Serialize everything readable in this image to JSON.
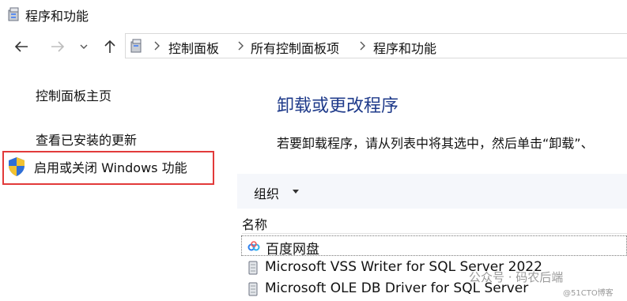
{
  "window": {
    "title": "程序和功能"
  },
  "nav": {
    "address": [
      "控制面板",
      "所有控制面板项",
      "程序和功能"
    ]
  },
  "sidebar": {
    "items": [
      {
        "label": "控制面板主页"
      },
      {
        "label": "查看已安装的更新"
      },
      {
        "label": "启用或关闭 Windows 功能"
      }
    ]
  },
  "main": {
    "heading": "卸载或更改程序",
    "description": "若要卸载程序，请从列表中将其选中，然后单击“卸载”、",
    "toolbar": {
      "organize_label": "组织"
    },
    "column_header": "名称",
    "programs": [
      {
        "name": "百度网盘",
        "icon": "baidu-netdisk-icon"
      },
      {
        "name": "Microsoft VSS Writer for SQL Server 2022",
        "icon": "installer-icon"
      },
      {
        "name": "Microsoft OLE DB Driver for SQL Server",
        "icon": "installer-icon"
      }
    ]
  },
  "watermark": {
    "text1": "公众号 · 码农后端",
    "text2": "@51CTO博客"
  },
  "colors": {
    "highlight_border": "#e23a3a",
    "heading": "#1e3a8a",
    "toolbar_bg": "#f5f7fb"
  }
}
